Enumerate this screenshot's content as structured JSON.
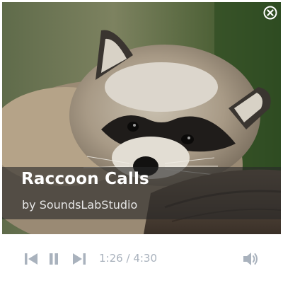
{
  "track": {
    "title": "Raccoon Calls",
    "artist": "by SoundsLabStudio"
  },
  "player": {
    "current_time": "1:26",
    "separator": "/",
    "duration": "4:30",
    "state": "playing"
  },
  "icons": {
    "close": "close-circle-icon",
    "previous": "skip-previous-icon",
    "pause": "pause-icon",
    "next": "skip-next-icon",
    "volume": "volume-icon"
  },
  "colors": {
    "control_gray": "#a9b2bd",
    "caption_overlay": "#282828"
  }
}
